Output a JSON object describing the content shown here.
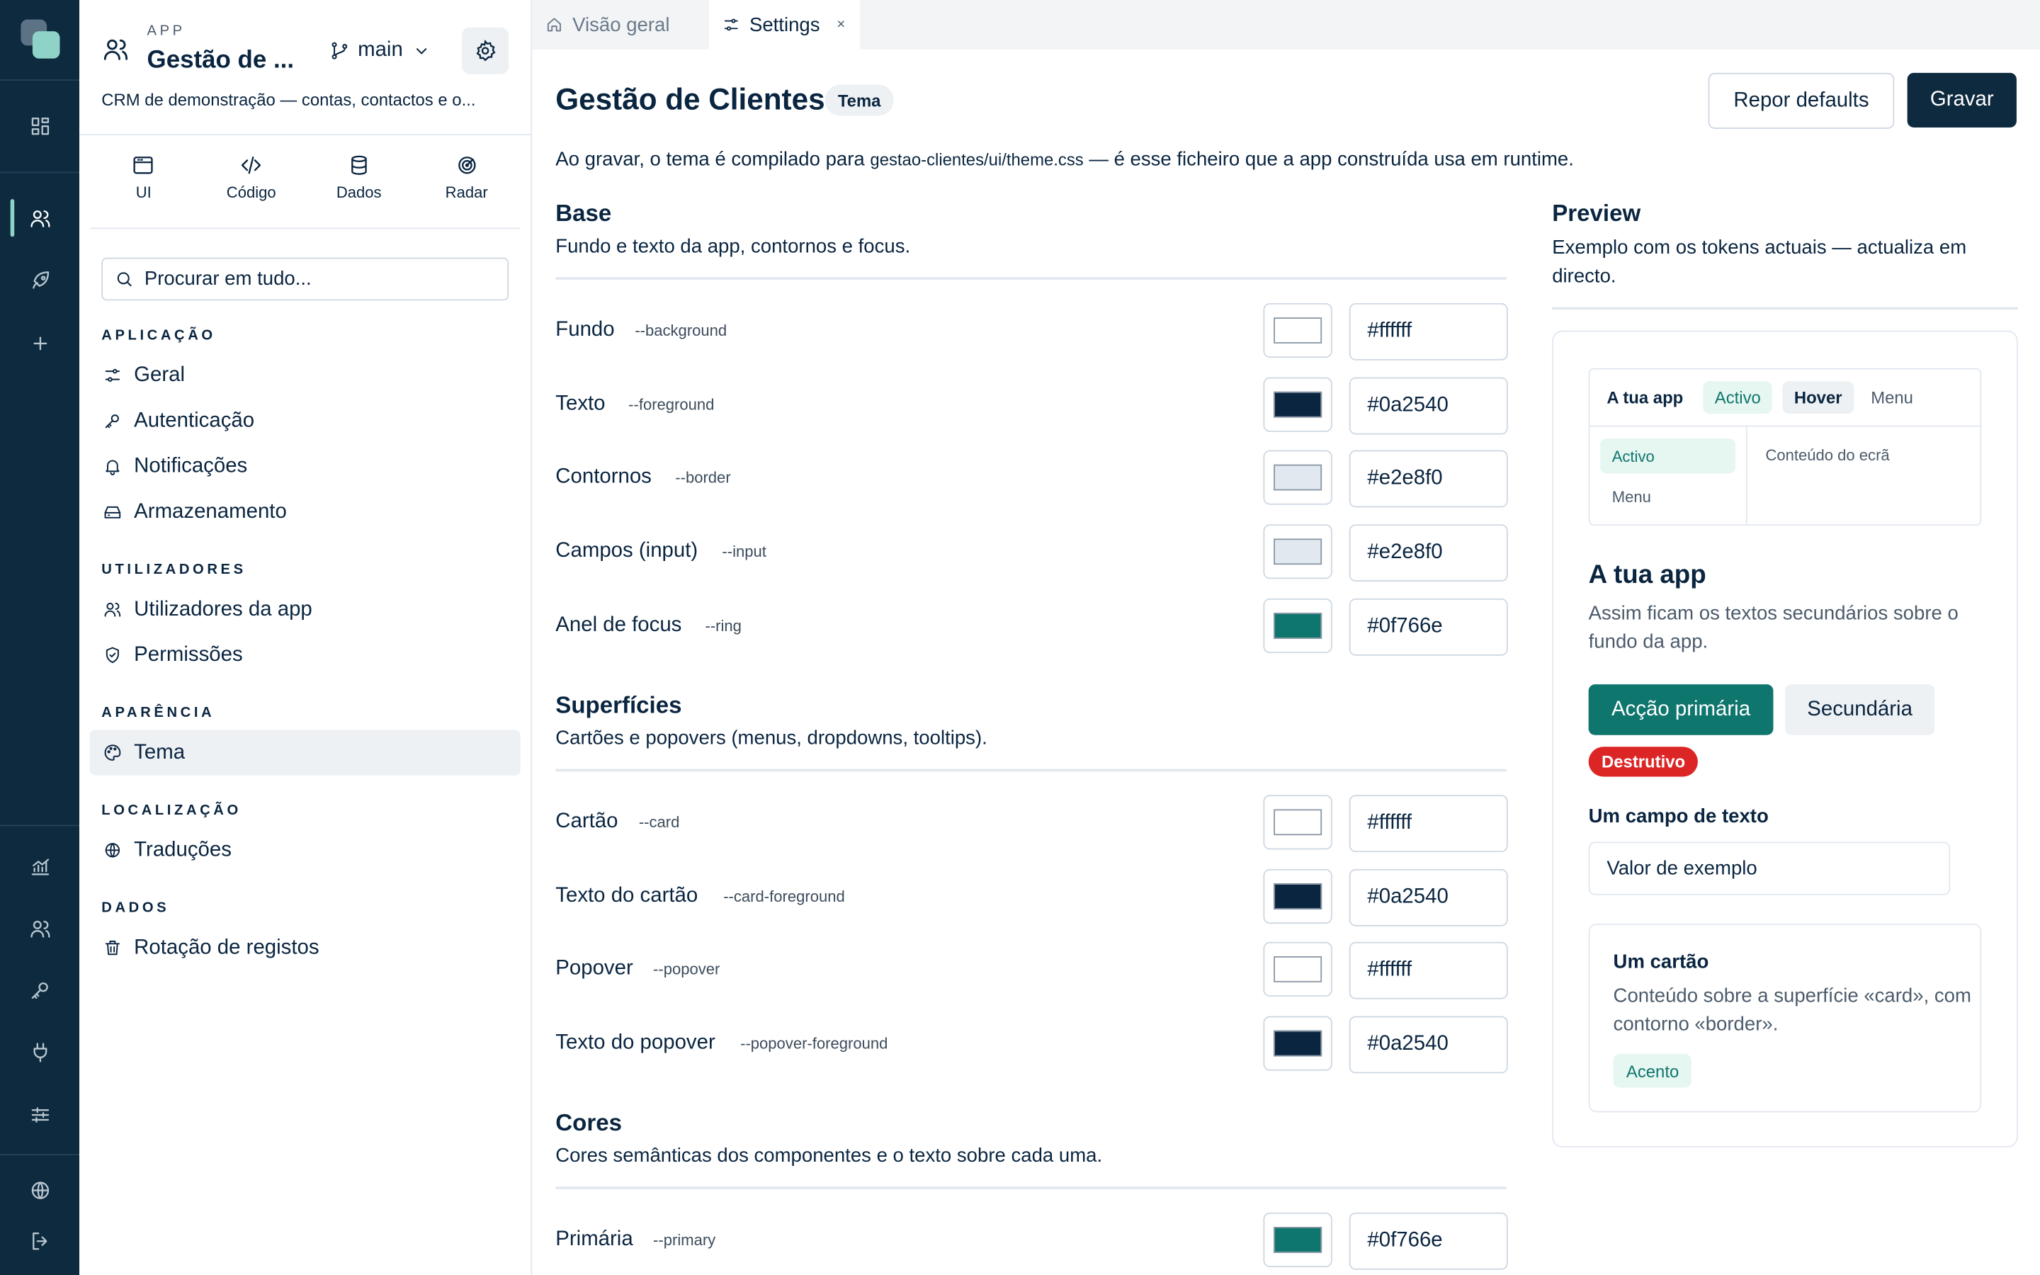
{
  "rail": {
    "icons": [
      "dashboard-icon",
      "users-icon",
      "rocket-icon",
      "plus-icon",
      "chart-icon",
      "users-icon",
      "key-icon",
      "plug-icon",
      "sliders-icon",
      "globe-icon",
      "logout-icon"
    ],
    "active": "users-icon"
  },
  "app": {
    "kicker": "APP",
    "name": "Gestão de ...",
    "branch": "main",
    "description": "CRM de demonstração — contas, contactos e o..."
  },
  "panel_tabs": [
    {
      "label": "UI",
      "icon": "window-icon"
    },
    {
      "label": "Código",
      "icon": "code-icon"
    },
    {
      "label": "Dados",
      "icon": "database-icon"
    },
    {
      "label": "Radar",
      "icon": "radar-icon"
    }
  ],
  "search": {
    "placeholder": "Procurar em tudo..."
  },
  "nav": {
    "sections": [
      {
        "title": "APLICAÇÃO",
        "items": [
          {
            "label": "Geral",
            "icon": "sliders-icon"
          },
          {
            "label": "Autenticação",
            "icon": "key-icon"
          },
          {
            "label": "Notificações",
            "icon": "bell-icon"
          },
          {
            "label": "Armazenamento",
            "icon": "drive-icon"
          }
        ]
      },
      {
        "title": "UTILIZADORES",
        "items": [
          {
            "label": "Utilizadores da app",
            "icon": "users-icon"
          },
          {
            "label": "Permissões",
            "icon": "shield-icon"
          }
        ]
      },
      {
        "title": "APARÊNCIA",
        "items": [
          {
            "label": "Tema",
            "icon": "palette-icon",
            "selected": true
          }
        ]
      },
      {
        "title": "LOCALIZAÇÃO",
        "items": [
          {
            "label": "Traduções",
            "icon": "globe-icon"
          }
        ]
      },
      {
        "title": "DADOS",
        "items": [
          {
            "label": "Rotação de registos",
            "icon": "trash-icon"
          }
        ]
      }
    ]
  },
  "tabs": [
    {
      "label": "Visão geral",
      "icon": "home-icon",
      "active": false
    },
    {
      "label": "Settings",
      "icon": "sliders-icon",
      "active": true,
      "close": "×"
    }
  ],
  "header": {
    "title": "Gestão de Clientes",
    "badge": "Tema",
    "reset_label": "Repor defaults",
    "save_label": "Gravar",
    "intro_before": "Ao gravar, o tema é compilado para ",
    "intro_path": "gestao-clientes/ui/theme.css",
    "intro_after": " — é esse ficheiro que a app construída usa em runtime."
  },
  "groups": [
    {
      "title": "Base",
      "subtitle": "Fundo e texto da app, contornos e focus.",
      "rows": [
        {
          "label": "Fundo",
          "token": "--background",
          "value": "#ffffff"
        },
        {
          "label": "Texto",
          "token": "--foreground",
          "value": "#0a2540"
        },
        {
          "label": "Contornos",
          "token": "--border",
          "value": "#e2e8f0"
        },
        {
          "label": "Campos (input)",
          "token": "--input",
          "value": "#e2e8f0"
        },
        {
          "label": "Anel de focus",
          "token": "--ring",
          "value": "#0f766e"
        }
      ]
    },
    {
      "title": "Superfícies",
      "subtitle": "Cartões e popovers (menus, dropdowns, tooltips).",
      "rows": [
        {
          "label": "Cartão",
          "token": "--card",
          "value": "#ffffff"
        },
        {
          "label": "Texto do cartão",
          "token": "--card-foreground",
          "value": "#0a2540"
        },
        {
          "label": "Popover",
          "token": "--popover",
          "value": "#ffffff"
        },
        {
          "label": "Texto do popover",
          "token": "--popover-foreground",
          "value": "#0a2540"
        }
      ]
    },
    {
      "title": "Cores",
      "subtitle": "Cores semânticas dos componentes e o texto sobre cada uma.",
      "rows": [
        {
          "label": "Primária",
          "token": "--primary",
          "value": "#0f766e"
        }
      ]
    }
  ],
  "preview": {
    "title": "Preview",
    "subtitle": "Exemplo com os tokens actuais — actualiza em directo.",
    "mock": {
      "app_name": "A tua app",
      "active": "Activo",
      "hover": "Hover",
      "menu": "Menu",
      "side_active": "Activo",
      "side_menu": "Menu",
      "content": "Conteúdo do ecrã"
    },
    "heading": "A tua app",
    "paragraph": "Assim ficam os textos secundários sobre o fundo da app.",
    "primary_button": "Acção primária",
    "secondary_button": "Secundária",
    "destructive": "Destrutivo",
    "field_label": "Um campo de texto",
    "field_value": "Valor de exemplo",
    "card": {
      "title": "Um cartão",
      "text": "Conteúdo sobre a superfície «card», com contorno «border».",
      "accent": "Acento"
    }
  },
  "colors": {
    "brand_dark": "#0d2a3e",
    "accent": "#0f766e",
    "destructive": "#dc2626"
  }
}
